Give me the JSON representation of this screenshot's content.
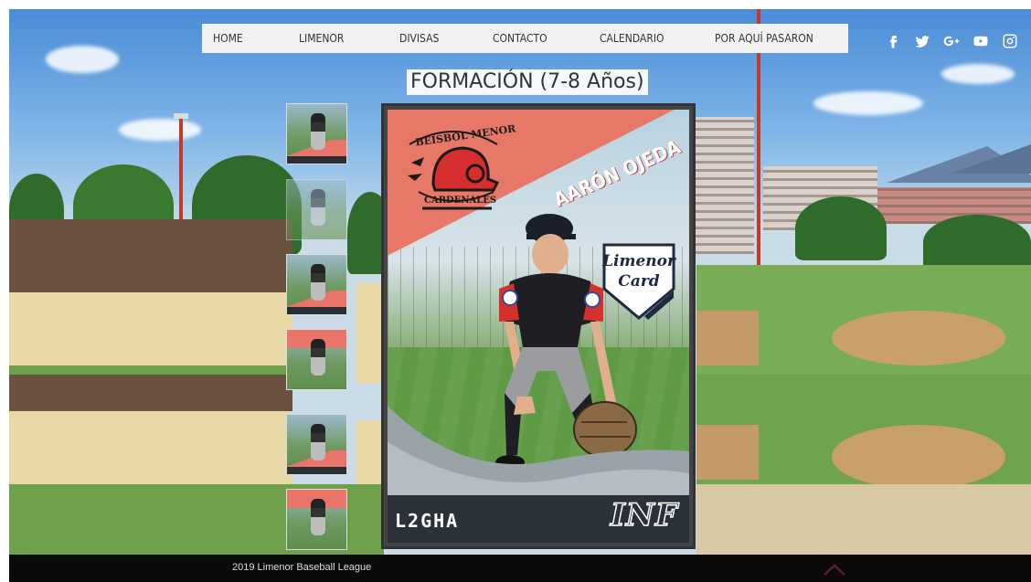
{
  "nav": {
    "items": [
      "HOME",
      "LIMENOR",
      "DIVISAS",
      "CONTACTO",
      "CALENDARIO",
      "POR AQUÍ PASARON"
    ]
  },
  "social": {
    "icons": [
      "facebook-icon",
      "twitter-icon",
      "google-plus-icon",
      "youtube-icon",
      "instagram-icon"
    ]
  },
  "page_title": "FORMACIÓN (7-8 Años)",
  "card": {
    "logo_top": "BEISBOL MENOR",
    "logo_bottom": "CARDENALES",
    "player_name": "AARÓN OJEDA",
    "badge_line1": "Limenor",
    "badge_line2": "Card",
    "code": "L2GHA",
    "position": "INF"
  },
  "thumbnails": {
    "count": 6
  },
  "footer": {
    "text": "2019 Limenor Baseball League"
  },
  "colors": {
    "card_accent": "#e77767",
    "card_dark": "#2b3139",
    "nav_bg": "#f2f2f2",
    "footer_bg": "#0a0a0a"
  }
}
